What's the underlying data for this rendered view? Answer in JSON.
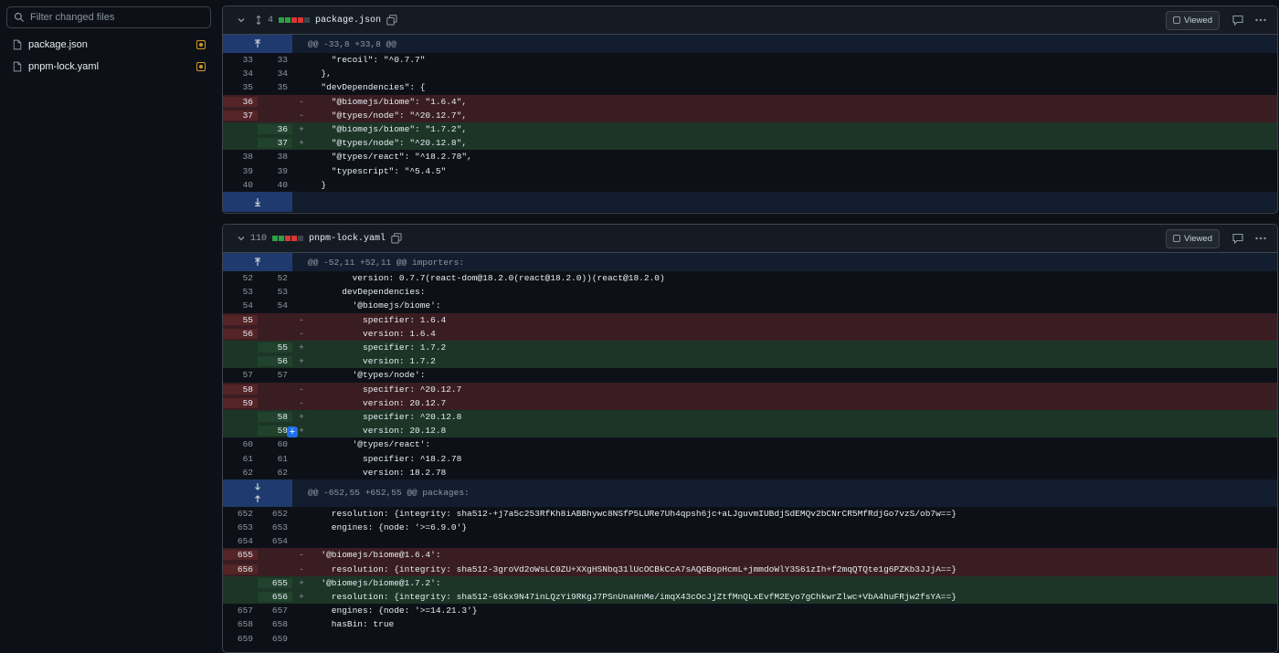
{
  "sidebar": {
    "filter_placeholder": "Filter changed files",
    "files": [
      {
        "name": "package.json"
      },
      {
        "name": "pnpm-lock.yaml"
      }
    ]
  },
  "files": [
    {
      "path": "package.json",
      "count": "4",
      "viewed_label": "Viewed",
      "hunk": "@@ -33,8 +33,8 @@",
      "lines": [
        {
          "t": "ctx",
          "o": "33",
          "n": "33",
          "c": "    \"recoil\": \"^0.7.7\""
        },
        {
          "t": "ctx",
          "o": "34",
          "n": "34",
          "c": "  },"
        },
        {
          "t": "ctx",
          "o": "35",
          "n": "35",
          "c": "  \"devDependencies\": {"
        },
        {
          "t": "del",
          "o": "36",
          "n": "",
          "c": "    \"@biomejs/biome\": \"1.6.4\","
        },
        {
          "t": "del",
          "o": "37",
          "n": "",
          "c": "    \"@types/node\": \"^20.12.7\","
        },
        {
          "t": "add",
          "o": "",
          "n": "36",
          "c": "    \"@biomejs/biome\": \"1.7.2\","
        },
        {
          "t": "add",
          "o": "",
          "n": "37",
          "c": "    \"@types/node\": \"^20.12.8\","
        },
        {
          "t": "ctx",
          "o": "38",
          "n": "38",
          "c": "    \"@types/react\": \"^18.2.78\","
        },
        {
          "t": "ctx",
          "o": "39",
          "n": "39",
          "c": "    \"typescript\": \"^5.4.5\""
        },
        {
          "t": "ctx",
          "o": "40",
          "n": "40",
          "c": "  }"
        }
      ]
    },
    {
      "path": "pnpm-lock.yaml",
      "count": "110",
      "viewed_label": "Viewed",
      "hunk": "@@ -52,11 +52,11 @@ importers:",
      "hunk2": "@@ -652,55 +652,55 @@ packages:",
      "lines": [
        {
          "t": "ctx",
          "o": "52",
          "n": "52",
          "c": "        version: 0.7.7(react-dom@18.2.0(react@18.2.0))(react@18.2.0)"
        },
        {
          "t": "ctx",
          "o": "53",
          "n": "53",
          "c": "      devDependencies:"
        },
        {
          "t": "ctx",
          "o": "54",
          "n": "54",
          "c": "        '@biomejs/biome':"
        },
        {
          "t": "del",
          "o": "55",
          "n": "",
          "c": "          specifier: 1.6.4"
        },
        {
          "t": "del",
          "o": "56",
          "n": "",
          "c": "          version: 1.6.4"
        },
        {
          "t": "add",
          "o": "",
          "n": "55",
          "c": "          specifier: 1.7.2"
        },
        {
          "t": "add",
          "o": "",
          "n": "56",
          "c": "          version: 1.7.2"
        },
        {
          "t": "ctx",
          "o": "57",
          "n": "57",
          "c": "        '@types/node':"
        },
        {
          "t": "del",
          "o": "58",
          "n": "",
          "c": "          specifier: ^20.12.7"
        },
        {
          "t": "del",
          "o": "59",
          "n": "",
          "c": "          version: 20.12.7"
        },
        {
          "t": "add",
          "o": "",
          "n": "58",
          "c": "          specifier: ^20.12.8"
        },
        {
          "t": "add",
          "o": "",
          "n": "59",
          "c": "          version: 20.12.8"
        },
        {
          "t": "ctx",
          "o": "60",
          "n": "60",
          "c": "        '@types/react':"
        },
        {
          "t": "ctx",
          "o": "61",
          "n": "61",
          "c": "          specifier: ^18.2.78"
        },
        {
          "t": "ctx",
          "o": "62",
          "n": "62",
          "c": "          version: 18.2.78"
        }
      ],
      "lines2": [
        {
          "t": "ctx",
          "o": "652",
          "n": "652",
          "c": "    resolution: {integrity: sha512-+j7a5c253RfKh8iABBhywc8NSfP5LURe7Uh4qpsh6jc+aLJguvmIUBdjSdEMQv2bCNrCR5MfRdjGo7vzS/ob7w==}"
        },
        {
          "t": "ctx",
          "o": "653",
          "n": "653",
          "c": "    engines: {node: '>=6.9.0'}"
        },
        {
          "t": "ctx",
          "o": "654",
          "n": "654",
          "c": ""
        },
        {
          "t": "del",
          "o": "655",
          "n": "",
          "c": "  '@biomejs/biome@1.6.4':"
        },
        {
          "t": "del",
          "o": "656",
          "n": "",
          "c": "    resolution: {integrity: sha512-3groVd2oWsLC0ZU+XXgHSNbq31lUcOCBkCcA7sAQGBopHcmL+jmmdoWlY3S61zIh+f2mqQTQte1g6PZKb3JJjA==}"
        },
        {
          "t": "add",
          "o": "",
          "n": "655",
          "c": "  '@biomejs/biome@1.7.2':"
        },
        {
          "t": "add",
          "o": "",
          "n": "656",
          "c": "    resolution: {integrity: sha512-6Skx9N47inLQzYi9RKgJ7PSnUnaHnMe/imqX43cOcJjZtfMnQLxEvfM2Eyo7gChkwrZlwc+VbA4huFRjw2fsYA==}"
        },
        {
          "t": "ctx",
          "o": "657",
          "n": "657",
          "c": "    engines: {node: '>=14.21.3'}"
        },
        {
          "t": "ctx",
          "o": "658",
          "n": "658",
          "c": "    hasBin: true"
        },
        {
          "t": "ctx",
          "o": "659",
          "n": "659",
          "c": ""
        }
      ]
    }
  ],
  "colors": {
    "added": "#2ea043",
    "deleted": "#da3633",
    "accent": "#1f6feb",
    "modified": "#d29922"
  }
}
